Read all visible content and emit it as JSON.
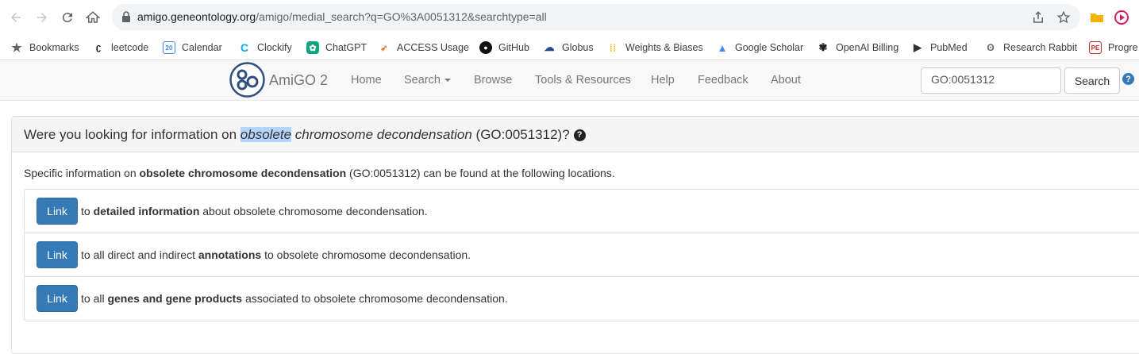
{
  "browser": {
    "url_host": "amigo.geneontology.org",
    "url_path": "/amigo/medial_search?q=GO%3A0051312&searchtype=all",
    "bookmarks": [
      {
        "label": "Bookmarks",
        "icon": "star-icon"
      },
      {
        "label": "leetcode",
        "icon": "leetcode-icon"
      },
      {
        "label": "Calendar",
        "icon": "calendar-icon"
      },
      {
        "label": "Clockify",
        "icon": "clockify-icon"
      },
      {
        "label": "ChatGPT",
        "icon": "chatgpt-icon"
      },
      {
        "label": "ACCESS Usage",
        "icon": "access-icon"
      },
      {
        "label": "GitHub",
        "icon": "github-icon"
      },
      {
        "label": "Globus",
        "icon": "globus-icon"
      },
      {
        "label": "Weights & Biases",
        "icon": "wandb-icon"
      },
      {
        "label": "Google Scholar",
        "icon": "scholar-icon"
      },
      {
        "label": "OpenAI Billing",
        "icon": "openai-icon"
      },
      {
        "label": "PubMed",
        "icon": "pubmed-icon"
      },
      {
        "label": "Research Rabbit",
        "icon": "rabbit-icon"
      },
      {
        "label": "Progre",
        "icon": "pe-icon"
      }
    ]
  },
  "navbar": {
    "brand": "AmiGO 2",
    "items": [
      "Home",
      "Search",
      "Browse",
      "Tools & Resources",
      "Help",
      "Feedback",
      "About"
    ],
    "search_value": "GO:0051312",
    "search_button": "Search"
  },
  "panel": {
    "title_prefix": "Were you looking for information on ",
    "title_highlight": "obsolete",
    "title_term_rest": " chromosome decondensation",
    "title_suffix": " (GO:0051312)?",
    "help_glyph": "?",
    "intro_prefix": "Specific information on ",
    "intro_term": "obsolete chromosome decondensation",
    "intro_suffix": " (GO:0051312) can be found at the following locations.",
    "link_label": "Link",
    "rows": [
      {
        "pre": "to ",
        "bold": "detailed information",
        "post": " about obsolete chromosome decondensation."
      },
      {
        "pre": "to all direct and indirect ",
        "bold": "annotations",
        "post": " to obsolete chromosome decondensation."
      },
      {
        "pre": "to all ",
        "bold": "genes and gene products",
        "post": " associated to obsolete chromosome decondensation."
      }
    ]
  },
  "colors": {
    "primary_button": "#337ab7",
    "navbar_bg": "#f8f8f8",
    "panel_heading_bg": "#f5f5f5",
    "selection": "#b3d4fc"
  }
}
